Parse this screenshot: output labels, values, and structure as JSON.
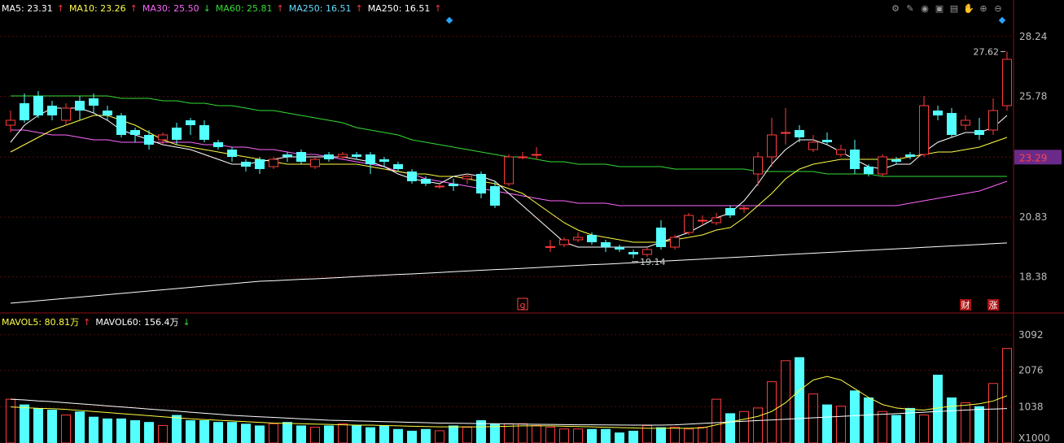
{
  "colors": {
    "up": "#ff3b3b",
    "down": "#54ffff",
    "ma5": "#ffffff",
    "ma10": "#ffff44",
    "ma30": "#ff66ff",
    "ma60": "#33dd33",
    "ma250": "#ffffff",
    "grid": "#5a0a0a",
    "axis_text": "#bbbbbb",
    "current_price_bg": "#6a2a8a"
  },
  "price_legend": [
    {
      "label": "MA5: 23.31",
      "arrow": "↑",
      "color": "#ffffff"
    },
    {
      "label": "MA10: 23.26",
      "arrow": "↑",
      "color": "#ffff44"
    },
    {
      "label": "MA30: 25.50",
      "arrow": "↓",
      "color": "#ff66ff"
    },
    {
      "label": "MA60: 25.81",
      "arrow": "↑",
      "color": "#33dd33"
    },
    {
      "label": "MA250: 16.51",
      "arrow": "↑",
      "color": "#66ddff"
    },
    {
      "label": "MA250: 16.51",
      "arrow": "↑",
      "color": "#ffffff"
    }
  ],
  "volume_legend": [
    {
      "label": "MAVOL5: 80.81万",
      "arrow": "↑",
      "color": "#ffff44"
    },
    {
      "label": "MAVOL60: 156.4万",
      "arrow": "↓",
      "color": "#ffffff"
    }
  ],
  "toolbar_icons": [
    "settings-icon",
    "pen-icon",
    "eye-icon",
    "bag-icon",
    "lock-icon",
    "hand-icon",
    "zoom-in-icon",
    "zoom-out-icon"
  ],
  "chart_data": [
    {
      "type": "candlestick",
      "price_axis_ticks": [
        "28.24",
        "25.78",
        "23.29",
        "20.83",
        "18.38"
      ],
      "tick_values": [
        28.24,
        25.78,
        23.29,
        20.83,
        18.38
      ],
      "current_price": "23.29",
      "ylim": [
        16.9,
        29.0
      ],
      "high_label": "27.62",
      "low_label": "19.14",
      "markers": [
        "g",
        "财",
        "涨"
      ],
      "candles": [
        [
          24.6,
          24.8,
          24.3,
          25.2
        ],
        [
          25.5,
          24.8,
          24.7,
          25.9
        ],
        [
          25.8,
          25.0,
          24.9,
          26.0
        ],
        [
          25.4,
          25.0,
          24.8,
          25.6
        ],
        [
          24.8,
          25.3,
          24.6,
          25.5
        ],
        [
          25.6,
          25.2,
          24.8,
          25.8
        ],
        [
          25.7,
          25.4,
          25.1,
          25.9
        ],
        [
          25.2,
          25.0,
          24.8,
          25.4
        ],
        [
          25.0,
          24.2,
          24.1,
          25.1
        ],
        [
          24.4,
          24.2,
          23.9,
          24.5
        ],
        [
          24.2,
          23.8,
          23.6,
          24.4
        ],
        [
          24.0,
          24.2,
          23.8,
          24.3
        ],
        [
          24.5,
          24.0,
          23.8,
          24.7
        ],
        [
          24.8,
          24.6,
          24.2,
          24.9
        ],
        [
          24.6,
          24.0,
          23.9,
          24.8
        ],
        [
          23.9,
          23.7,
          23.6,
          24.0
        ],
        [
          23.6,
          23.3,
          23.1,
          23.7
        ],
        [
          23.1,
          22.9,
          22.7,
          23.2
        ],
        [
          23.2,
          22.8,
          22.6,
          23.3
        ],
        [
          22.9,
          23.2,
          22.8,
          23.3
        ],
        [
          23.4,
          23.3,
          23.1,
          23.5
        ],
        [
          23.5,
          23.1,
          23.0,
          23.6
        ],
        [
          22.9,
          23.2,
          22.8,
          23.3
        ],
        [
          23.4,
          23.2,
          23.1,
          23.5
        ],
        [
          23.3,
          23.4,
          23.2,
          23.5
        ],
        [
          23.4,
          23.3,
          23.2,
          23.5
        ],
        [
          23.4,
          23.0,
          22.6,
          23.5
        ],
        [
          23.2,
          23.1,
          22.9,
          23.3
        ],
        [
          23.0,
          22.8,
          22.7,
          23.1
        ],
        [
          22.7,
          22.3,
          22.2,
          22.8
        ],
        [
          22.4,
          22.2,
          22.1,
          22.5
        ],
        [
          22.1,
          22.1,
          22.0,
          22.2
        ],
        [
          22.2,
          22.1,
          21.9,
          22.4
        ],
        [
          22.4,
          22.5,
          22.2,
          22.6
        ],
        [
          22.6,
          21.8,
          21.6,
          22.7
        ],
        [
          22.1,
          21.3,
          21.2,
          22.3
        ],
        [
          22.2,
          23.3,
          22.1,
          23.4
        ],
        [
          23.3,
          23.3,
          23.2,
          23.5
        ],
        [
          23.4,
          23.4,
          23.2,
          23.7
        ],
        [
          19.6,
          19.62,
          19.4,
          19.9
        ],
        [
          19.7,
          19.9,
          19.6,
          20.0
        ],
        [
          19.9,
          20.0,
          19.8,
          20.2
        ],
        [
          20.1,
          19.8,
          19.7,
          20.2
        ],
        [
          19.8,
          19.6,
          19.4,
          19.9
        ],
        [
          19.6,
          19.5,
          19.4,
          19.7
        ],
        [
          19.4,
          19.3,
          19.14,
          19.5
        ],
        [
          19.3,
          19.5,
          19.2,
          19.6
        ],
        [
          20.4,
          19.6,
          19.5,
          20.7
        ],
        [
          19.6,
          20.0,
          19.5,
          20.1
        ],
        [
          20.2,
          20.9,
          20.1,
          21.0
        ],
        [
          20.7,
          20.7,
          20.5,
          20.9
        ],
        [
          20.6,
          20.8,
          20.5,
          21.0
        ],
        [
          21.2,
          20.9,
          20.8,
          21.3
        ],
        [
          21.2,
          21.2,
          21.0,
          21.3
        ],
        [
          22.6,
          23.3,
          22.1,
          23.5
        ],
        [
          23.3,
          24.2,
          22.9,
          24.9
        ],
        [
          24.3,
          24.3,
          23.8,
          25.3
        ],
        [
          24.4,
          24.1,
          23.9,
          24.6
        ],
        [
          23.6,
          23.9,
          23.5,
          24.2
        ],
        [
          24.0,
          23.9,
          23.8,
          24.3
        ],
        [
          23.4,
          23.6,
          23.3,
          23.8
        ],
        [
          23.6,
          22.8,
          22.6,
          24.0
        ],
        [
          22.9,
          22.6,
          22.5,
          23.0
        ],
        [
          22.6,
          23.3,
          22.5,
          23.4
        ],
        [
          23.2,
          23.1,
          23.0,
          23.3
        ],
        [
          23.4,
          23.3,
          23.2,
          23.5
        ],
        [
          23.4,
          25.4,
          23.3,
          25.8
        ],
        [
          25.2,
          25.0,
          24.8,
          25.4
        ],
        [
          25.1,
          24.2,
          24.1,
          25.3
        ],
        [
          24.6,
          24.8,
          24.4,
          25.0
        ],
        [
          24.4,
          24.2,
          24.0,
          24.9
        ],
        [
          24.4,
          25.2,
          24.2,
          25.7
        ],
        [
          25.4,
          27.3,
          25.2,
          27.62
        ]
      ],
      "ma5": [
        23.9,
        24.6,
        25.0,
        25.3,
        25.3,
        25.3,
        25.1,
        24.8,
        24.4,
        24.2,
        24.0,
        23.8,
        23.7,
        23.6,
        23.4,
        23.2,
        23.0,
        23.0,
        23.1,
        23.2,
        23.3,
        23.3,
        23.3,
        23.3,
        23.3,
        23.2,
        23.1,
        22.9,
        22.6,
        22.4,
        22.3,
        22.2,
        22.5,
        22.6,
        22.5,
        22.3,
        21.8,
        21.3,
        20.8,
        20.3,
        19.8,
        19.6,
        19.6,
        19.6,
        19.6,
        19.6,
        19.6,
        19.8,
        20.0,
        20.2,
        20.5,
        20.8,
        21.0,
        21.5,
        22.2,
        23.0,
        23.6,
        24.0,
        24.0,
        23.8,
        23.5,
        23.2,
        22.9,
        22.8,
        23.0,
        23.0,
        23.5,
        23.9,
        24.1,
        24.3,
        24.3,
        24.5,
        25.0
      ],
      "ma10": [
        23.5,
        23.8,
        24.1,
        24.4,
        24.6,
        24.8,
        25.0,
        25.0,
        24.8,
        24.6,
        24.3,
        24.0,
        23.8,
        23.7,
        23.6,
        23.5,
        23.4,
        23.3,
        23.2,
        23.1,
        23.0,
        23.0,
        23.0,
        23.0,
        23.0,
        23.0,
        22.9,
        22.8,
        22.7,
        22.6,
        22.6,
        22.5,
        22.5,
        22.4,
        22.3,
        22.2,
        22.0,
        21.8,
        21.4,
        21.0,
        20.6,
        20.3,
        20.1,
        20.0,
        19.9,
        19.8,
        19.8,
        19.8,
        19.9,
        20.0,
        20.1,
        20.3,
        20.4,
        20.8,
        21.3,
        21.8,
        22.4,
        22.8,
        23.0,
        23.1,
        23.2,
        23.2,
        23.2,
        23.2,
        23.2,
        23.3,
        23.4,
        23.5,
        23.5,
        23.6,
        23.7,
        23.9,
        24.1
      ],
      "ma30": [
        24.4,
        24.4,
        24.3,
        24.2,
        24.2,
        24.1,
        24.0,
        24.0,
        23.9,
        23.9,
        23.9,
        23.9,
        23.9,
        23.9,
        23.8,
        23.8,
        23.7,
        23.7,
        23.6,
        23.6,
        23.5,
        23.4,
        23.4,
        23.3,
        23.2,
        23.1,
        23.0,
        22.9,
        22.7,
        22.6,
        22.4,
        22.3,
        22.2,
        22.1,
        22.0,
        21.9,
        21.8,
        21.7,
        21.6,
        21.5,
        21.5,
        21.4,
        21.4,
        21.4,
        21.3,
        21.3,
        21.3,
        21.3,
        21.3,
        21.3,
        21.3,
        21.3,
        21.3,
        21.3,
        21.3,
        21.3,
        21.3,
        21.3,
        21.3,
        21.3,
        21.3,
        21.3,
        21.3,
        21.3,
        21.3,
        21.4,
        21.5,
        21.6,
        21.7,
        21.8,
        21.9,
        22.1,
        22.3
      ],
      "ma60": [
        25.8,
        25.8,
        25.8,
        25.8,
        25.8,
        25.8,
        25.8,
        25.8,
        25.7,
        25.7,
        25.7,
        25.6,
        25.6,
        25.5,
        25.5,
        25.4,
        25.4,
        25.3,
        25.2,
        25.2,
        25.1,
        25.0,
        24.9,
        24.8,
        24.7,
        24.5,
        24.4,
        24.3,
        24.2,
        24.0,
        23.9,
        23.8,
        23.7,
        23.6,
        23.5,
        23.4,
        23.3,
        23.3,
        23.2,
        23.1,
        23.1,
        23.0,
        23.0,
        23.0,
        22.9,
        22.9,
        22.9,
        22.9,
        22.8,
        22.8,
        22.8,
        22.8,
        22.8,
        22.8,
        22.7,
        22.7,
        22.7,
        22.7,
        22.7,
        22.6,
        22.6,
        22.6,
        22.6,
        22.5,
        22.5,
        22.5,
        22.5,
        22.5,
        22.5,
        22.5,
        22.5,
        22.5,
        22.5
      ],
      "ma250": [
        17.3,
        17.35,
        17.4,
        17.45,
        17.5,
        17.55,
        17.6,
        17.65,
        17.7,
        17.75,
        17.8,
        17.85,
        17.9,
        17.95,
        18.0,
        18.05,
        18.1,
        18.15,
        18.2,
        18.22,
        18.25,
        18.28,
        18.3,
        18.33,
        18.36,
        18.39,
        18.42,
        18.45,
        18.48,
        18.5,
        18.53,
        18.56,
        18.59,
        18.62,
        18.65,
        18.68,
        18.7,
        18.73,
        18.76,
        18.79,
        18.82,
        18.85,
        18.88,
        18.9,
        18.93,
        18.96,
        18.99,
        19.02,
        19.05,
        19.08,
        19.11,
        19.14,
        19.17,
        19.2,
        19.23,
        19.26,
        19.29,
        19.32,
        19.35,
        19.38,
        19.41,
        19.44,
        19.47,
        19.5,
        19.53,
        19.56,
        19.59,
        19.62,
        19.65,
        19.68,
        19.71,
        19.74,
        19.77
      ]
    },
    {
      "type": "bar",
      "volume_axis_ticks": [
        "3092",
        "2076",
        "1038",
        "X1000"
      ],
      "tick_values": [
        3092,
        2076,
        1038
      ],
      "ylim": [
        0,
        3250
      ],
      "volume": [
        1250,
        1100,
        1000,
        950,
        800,
        900,
        750,
        700,
        700,
        650,
        600,
        500,
        800,
        650,
        650,
        600,
        600,
        550,
        500,
        550,
        600,
        500,
        450,
        500,
        550,
        500,
        450,
        500,
        400,
        350,
        400,
        350,
        500,
        450,
        650,
        550,
        550,
        550,
        500,
        450,
        400,
        400,
        400,
        400,
        300,
        350,
        500,
        450,
        450,
        400,
        450,
        1250,
        850,
        900,
        1000,
        1750,
        2350,
        2450,
        1400,
        1100,
        1050,
        1500,
        1300,
        900,
        800,
        1000,
        800,
        1950,
        1300,
        1150,
        1050,
        1700,
        2700
      ],
      "mavol5": [
        1030,
        1010,
        990,
        980,
        960,
        930,
        900,
        870,
        840,
        810,
        780,
        750,
        720,
        690,
        670,
        650,
        630,
        610,
        590,
        570,
        560,
        550,
        540,
        530,
        520,
        510,
        510,
        500,
        490,
        480,
        470,
        460,
        460,
        460,
        460,
        470,
        480,
        490,
        490,
        490,
        480,
        470,
        460,
        450,
        440,
        430,
        420,
        420,
        420,
        420,
        430,
        520,
        600,
        680,
        760,
        900,
        1150,
        1500,
        1800,
        1900,
        1800,
        1550,
        1300,
        1100,
        1000,
        960,
        940,
        1000,
        1050,
        1080,
        1120,
        1200,
        1350
      ],
      "mavol60": [
        1250,
        1230,
        1200,
        1180,
        1150,
        1120,
        1090,
        1060,
        1030,
        1000,
        970,
        940,
        910,
        880,
        850,
        820,
        790,
        770,
        750,
        730,
        710,
        690,
        670,
        650,
        640,
        630,
        620,
        610,
        600,
        590,
        580,
        570,
        565,
        560,
        555,
        550,
        545,
        540,
        535,
        530,
        525,
        520,
        518,
        516,
        514,
        512,
        510,
        510,
        520,
        540,
        560,
        580,
        600,
        620,
        640,
        660,
        680,
        700,
        720,
        740,
        760,
        780,
        800,
        820,
        840,
        860,
        880,
        900,
        920,
        940,
        960,
        970,
        985
      ]
    }
  ]
}
